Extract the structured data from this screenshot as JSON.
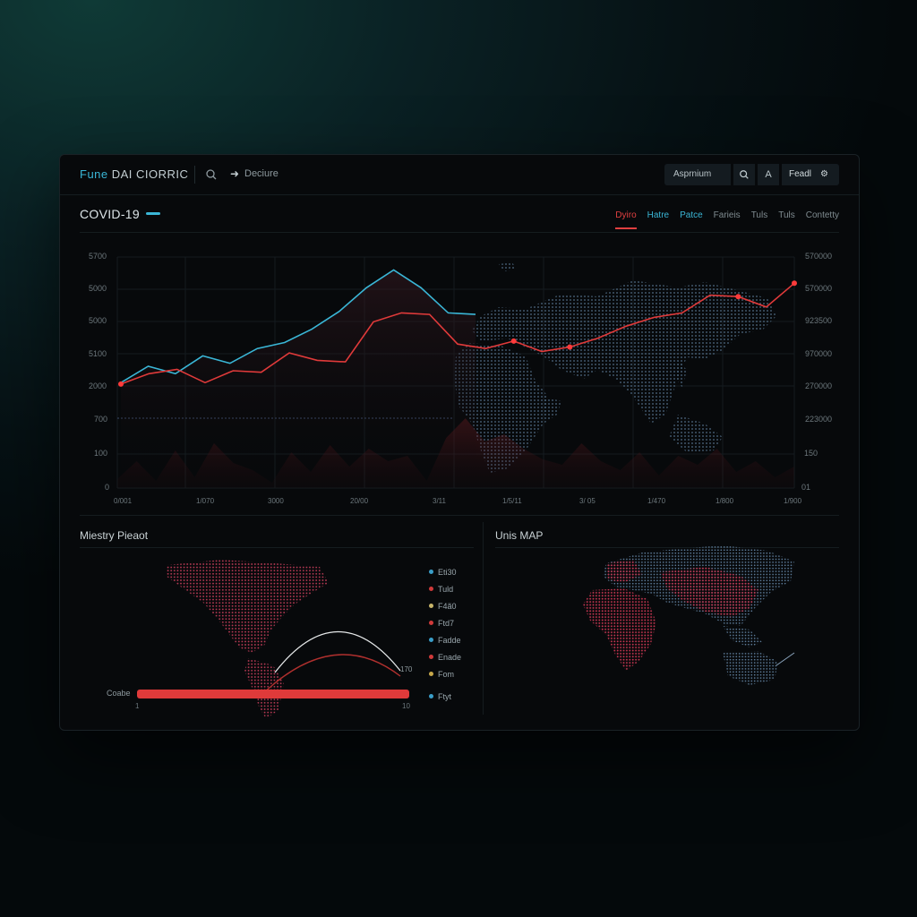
{
  "header": {
    "brand_prefix": "Fune",
    "brand_rest": " DAI CIORRIC",
    "nav_label": "Deciure",
    "search_value": "Asprnium",
    "user_label": "Feadl"
  },
  "section": {
    "title": "COVID-19",
    "tabs": [
      {
        "label": "Dyiro"
      },
      {
        "label": "Hatre"
      },
      {
        "label": "Patce"
      },
      {
        "label": "Farieis"
      },
      {
        "label": "Tuls"
      },
      {
        "label": "Tuls"
      },
      {
        "label": "Contetty"
      }
    ]
  },
  "chart_data": {
    "type": "line",
    "title": "",
    "xlabel": "",
    "ylabel": "",
    "y_left_ticks": [
      "5700",
      "5000",
      "5000",
      "5100",
      "2000",
      "700",
      "100",
      "0"
    ],
    "y_right_ticks": [
      "570000",
      "570000",
      "923500",
      "970000",
      "270000",
      "223000",
      "150",
      "01"
    ],
    "x_ticks": [
      "0/001",
      "1/070",
      "3000",
      "20/00",
      "3/11",
      "1/5/11",
      "3/ 05",
      "1/470",
      "1/800",
      "1/900"
    ],
    "series": [
      {
        "values": [
          24,
          35,
          30,
          42,
          37,
          47,
          51,
          60,
          72,
          88,
          100,
          88,
          71,
          70
        ]
      },
      {
        "values": [
          23,
          30,
          33,
          24,
          32,
          31,
          44,
          39,
          38,
          65,
          71,
          70,
          50,
          47,
          52,
          45,
          48,
          54,
          62,
          68,
          71,
          83,
          82,
          75,
          91
        ]
      }
    ],
    "colors": {
      "series_blue": "#3ab6d6",
      "series_red": "#e03a3a"
    }
  },
  "panels": {
    "left_title": "Miestry Pieaot",
    "right_title": "Unis MAP",
    "bar_label": "Coabe",
    "bar_min": "1",
    "bar_max": "10",
    "arc_value": "170",
    "legend": [
      {
        "label": "Eti30",
        "color": "#3a9ec8"
      },
      {
        "label": "Tuld",
        "color": "#d03a3a"
      },
      {
        "label": "F4ã0",
        "color": "#c7b56a"
      },
      {
        "label": "Ftd7",
        "color": "#d03a3a"
      },
      {
        "label": "Fadde",
        "color": "#3a9ec8"
      },
      {
        "label": "Enade",
        "color": "#d03a3a"
      },
      {
        "label": "Fom",
        "color": "#c7a84a"
      },
      {
        "label": "Ftyt",
        "color": "#3a9ec8"
      }
    ]
  }
}
